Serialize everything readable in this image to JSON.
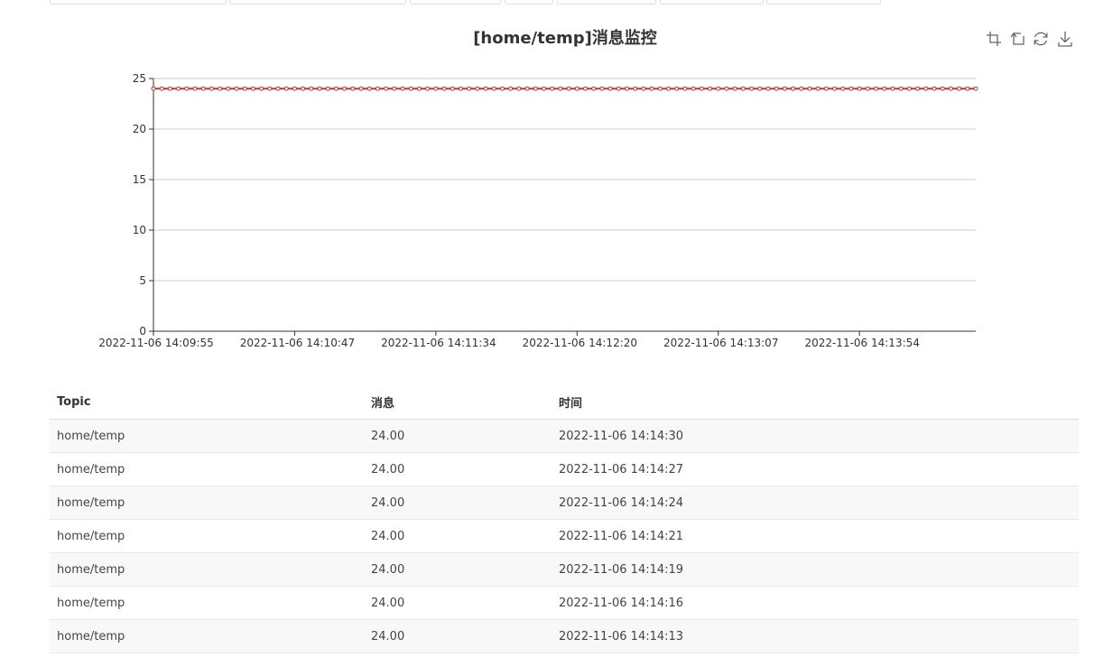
{
  "chart": {
    "title": "[home/temp]消息监控",
    "toolbox": [
      {
        "name": "zoom-icon"
      },
      {
        "name": "zoom-reset-icon"
      },
      {
        "name": "restore-icon"
      },
      {
        "name": "download-icon"
      }
    ],
    "colors": {
      "series": "#c23531",
      "axis": "#333333",
      "grid": "#cccccc"
    }
  },
  "chart_data": {
    "type": "line",
    "x_start": "2022-11-06 14:09:55",
    "x_end": "2022-11-06 14:14:30",
    "x_tick_labels": [
      "2022-11-06 14:09:55",
      "2022-11-06 14:10:47",
      "2022-11-06 14:11:34",
      "2022-11-06 14:12:20",
      "2022-11-06 14:13:07",
      "2022-11-06 14:13:54"
    ],
    "y_ticks": [
      0,
      5,
      10,
      15,
      20,
      25
    ],
    "ylim": [
      0,
      25
    ],
    "grid": true,
    "series": [
      {
        "values": [
          24,
          24,
          24,
          24,
          24,
          24,
          24,
          24,
          24,
          24,
          24,
          24,
          24,
          24,
          24,
          24,
          24,
          24,
          24,
          24,
          24,
          24,
          24,
          24,
          24,
          24,
          24,
          24,
          24,
          24,
          24,
          24,
          24,
          24,
          24,
          24,
          24,
          24,
          24,
          24,
          24,
          24,
          24,
          24,
          24,
          24,
          24,
          24,
          24,
          24,
          24,
          24,
          24,
          24,
          24,
          24,
          24,
          24,
          24,
          24,
          24,
          24,
          24,
          24,
          24,
          24,
          24,
          24,
          24,
          24,
          24,
          24,
          24,
          24,
          24,
          24,
          24,
          24,
          24,
          24,
          24,
          24,
          24,
          24,
          24,
          24,
          24,
          24,
          24,
          24,
          24,
          24,
          24,
          24,
          24,
          24,
          24,
          24,
          24,
          24
        ]
      }
    ]
  },
  "table": {
    "headers": [
      "Topic",
      "消息",
      "时间"
    ],
    "rows": [
      [
        "home/temp",
        "24.00",
        "2022-11-06 14:14:30"
      ],
      [
        "home/temp",
        "24.00",
        "2022-11-06 14:14:27"
      ],
      [
        "home/temp",
        "24.00",
        "2022-11-06 14:14:24"
      ],
      [
        "home/temp",
        "24.00",
        "2022-11-06 14:14:21"
      ],
      [
        "home/temp",
        "24.00",
        "2022-11-06 14:14:19"
      ],
      [
        "home/temp",
        "24.00",
        "2022-11-06 14:14:16"
      ],
      [
        "home/temp",
        "24.00",
        "2022-11-06 14:14:13"
      ]
    ]
  }
}
